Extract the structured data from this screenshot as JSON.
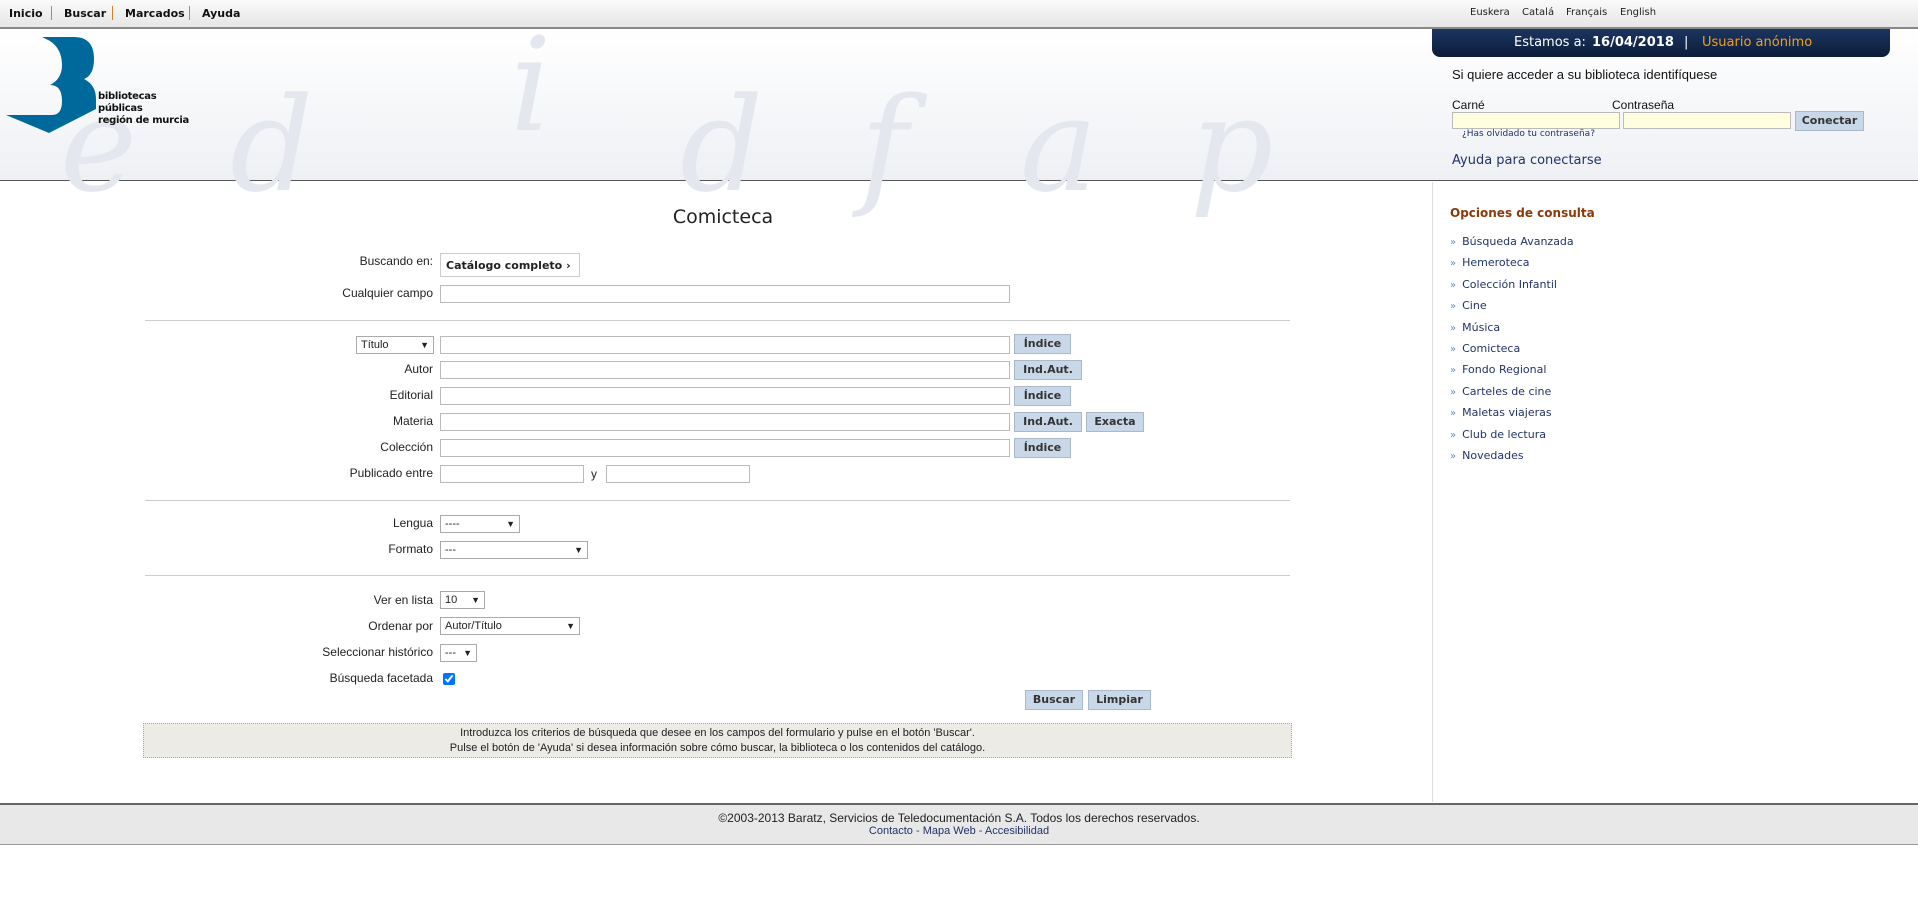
{
  "topnav": {
    "items": [
      "Inicio",
      "Buscar",
      "Marcados",
      "Ayuda"
    ],
    "languages": [
      "Euskera",
      "Catalá",
      "Français",
      "English"
    ]
  },
  "logo": {
    "line1": "bibliotecas públicas",
    "line2": "región de murcia",
    "color": "#00699b"
  },
  "login": {
    "date_prefix": "Estamos a:",
    "date": "16/04/2018",
    "sep": "|",
    "user": "Usuario anónimo",
    "prompt": "Si quiere acceder a su biblioteca identifíquese",
    "card_label": "Carné",
    "card_value": "",
    "password_label": "Contraseña",
    "password_value": "",
    "connect": "Conectar",
    "forgot": "¿Has olvidado tu contraseña?",
    "help": "Ayuda para conectarse"
  },
  "main": {
    "title": "Comicteca",
    "searching_in_label": "Buscando en:",
    "searching_in_value": "Catálogo completo",
    "any_field_label": "Cualquier campo",
    "field_select": "Título",
    "autor_label": "Autor",
    "editorial_label": "Editorial",
    "materia_label": "Materia",
    "coleccion_label": "Colección",
    "published_label": "Publicado entre",
    "published_and": "y",
    "indice": "Índice",
    "indaut": "Ind.Aut.",
    "exacta": "Exacta",
    "lengua_label": "Lengua",
    "lengua_value": "----",
    "formato_label": "Formato",
    "formato_value": "---",
    "ver_label": "Ver en lista",
    "ver_value": "10",
    "ordenar_label": "Ordenar por",
    "ordenar_value": "Autor/Título",
    "historico_label": "Seleccionar histórico",
    "historico_value": "---",
    "facet_label": "Búsqueda facetada",
    "facet_checked": true,
    "buscar": "Buscar",
    "limpiar": "Limpiar",
    "info1": "Introduzca los criterios de búsqueda que desee en los campos del formulario y pulse en el botón 'Buscar'.",
    "info2": "Pulse el botón de 'Ayuda' si desea información sobre cómo buscar, la biblioteca o los contenidos del catálogo."
  },
  "sidebar": {
    "title": "Opciones de consulta",
    "items": [
      "Búsqueda Avanzada",
      "Hemeroteca",
      "Colección Infantil",
      "Cine",
      "Música",
      "Comicteca",
      "Fondo Regional",
      "Carteles de cine",
      "Maletas viajeras",
      "Club de lectura",
      "Novedades"
    ]
  },
  "footer": {
    "copyright": "©2003-2013 Baratz, Servicios de Teledocumentación S.A. Todos los derechos reservados.",
    "links": [
      "Contacto",
      "Mapa Web",
      "Accesibilidad"
    ],
    "link_sep": "-"
  }
}
